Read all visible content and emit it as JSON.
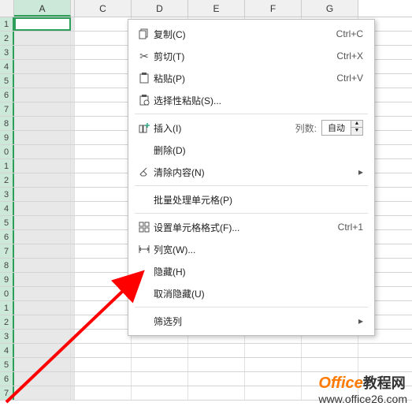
{
  "columns": [
    "A",
    "C",
    "D",
    "E",
    "F",
    "G"
  ],
  "selected_col_index": 0,
  "narrow_between": true,
  "row_labels": [
    "1",
    "2",
    "3",
    "4",
    "5",
    "6",
    "7",
    "8",
    "9",
    "0",
    "1",
    "2",
    "3",
    "4",
    "5",
    "6",
    "7",
    "8",
    "9",
    "0",
    "1",
    "2",
    "3",
    "4",
    "5",
    "6",
    "7"
  ],
  "menu": {
    "copy": {
      "label": "复制(C)",
      "shortcut": "Ctrl+C"
    },
    "cut": {
      "label": "剪切(T)",
      "shortcut": "Ctrl+X"
    },
    "paste": {
      "label": "粘贴(P)",
      "shortcut": "Ctrl+V"
    },
    "paste_special": {
      "label": "选择性粘贴(S)..."
    },
    "insert": {
      "label": "插入(I)",
      "count_label": "列数:",
      "spinner_value": "自动"
    },
    "delete": {
      "label": "删除(D)"
    },
    "clear": {
      "label": "清除内容(N)"
    },
    "batch": {
      "label": "批量处理单元格(P)"
    },
    "format": {
      "label": "设置单元格格式(F)...",
      "shortcut": "Ctrl+1"
    },
    "col_width": {
      "label": "列宽(W)..."
    },
    "hide": {
      "label": "隐藏(H)"
    },
    "unhide": {
      "label": "取消隐藏(U)"
    },
    "filter": {
      "label": "筛选列"
    }
  },
  "watermark": {
    "brand": "Office",
    "rest": "教程网",
    "url": "www.office26.com"
  }
}
